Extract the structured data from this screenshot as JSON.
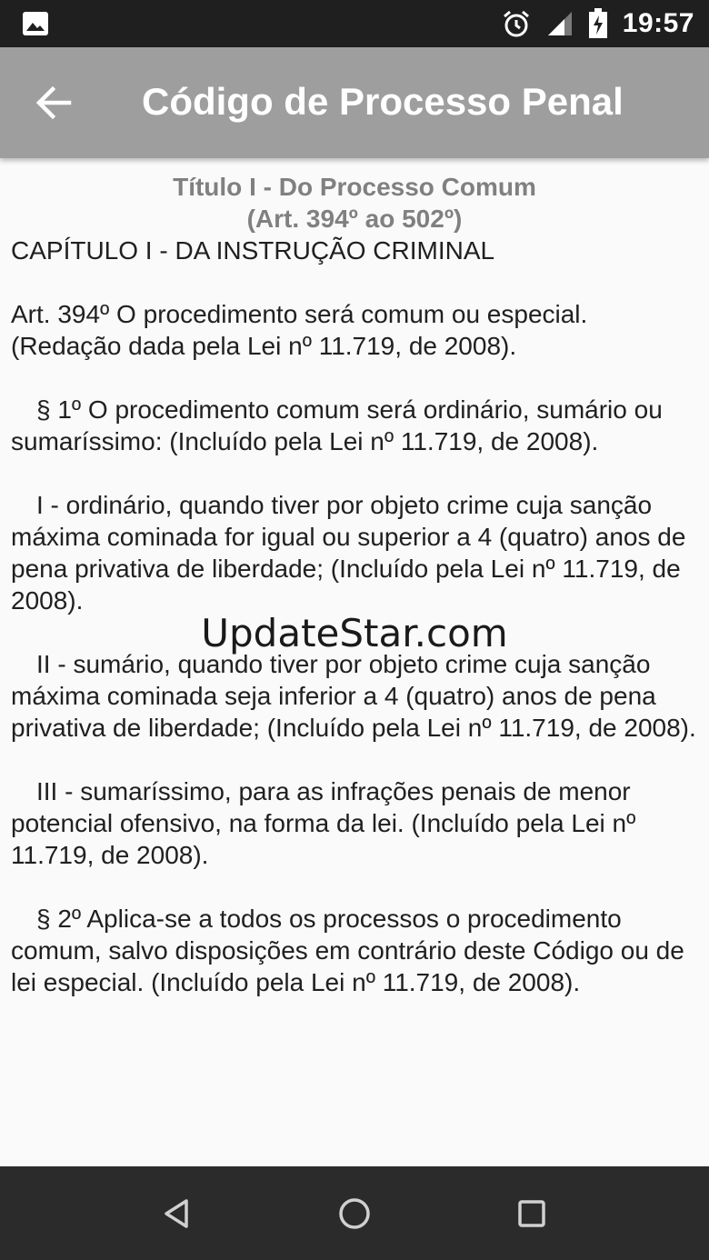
{
  "status_bar": {
    "time": "19:57",
    "icons": [
      "image-icon",
      "alarm-icon",
      "signal-icon",
      "battery-icon"
    ]
  },
  "app_bar": {
    "title": "Código de Processo Penal",
    "back_icon": "arrow-left-icon"
  },
  "content": {
    "heading_line1": "Título I - Do Processo Comum",
    "heading_line2": "(Art. 394º ao 502º)",
    "chapter": "CAPÍTULO I - DA INSTRUÇÃO CRIMINAL",
    "paragraphs": [
      "Art. 394º O procedimento será comum ou especial. (Redação dada pela Lei nº 11.719, de 2008).",
      "§ 1º O procedimento comum será ordinário, sumário ou sumaríssimo: (Incluído pela Lei nº 11.719, de 2008).",
      "I - ordinário, quando tiver por objeto crime cuja sanção máxima cominada for igual ou superior a 4 (quatro) anos de pena privativa de liberdade; (Incluído pela Lei nº 11.719, de 2008).",
      "II - sumário, quando tiver por objeto crime cuja sanção máxima cominada seja inferior a 4 (quatro) anos de pena privativa de liberdade; (Incluído pela Lei nº 11.719, de 2008).",
      "III - sumaríssimo, para as infrações penais de menor potencial ofensivo, na forma da lei. (Incluído pela Lei nº 11.719, de 2008).",
      "§ 2º Aplica-se a todos os processos o procedimento comum, salvo disposições em contrário deste Código ou de lei especial. (Incluído pela Lei nº 11.719, de 2008)."
    ]
  },
  "watermark": "UpdateStar.com",
  "nav_bar": {
    "icons": [
      "back-triangle-icon",
      "home-circle-icon",
      "recents-square-icon"
    ]
  },
  "colors": {
    "status_bar": "#1f1f1f",
    "app_bar": "#9e9e9e",
    "heading_text": "#808080",
    "body_text": "#202020",
    "nav_bar": "#2b2b2b"
  }
}
